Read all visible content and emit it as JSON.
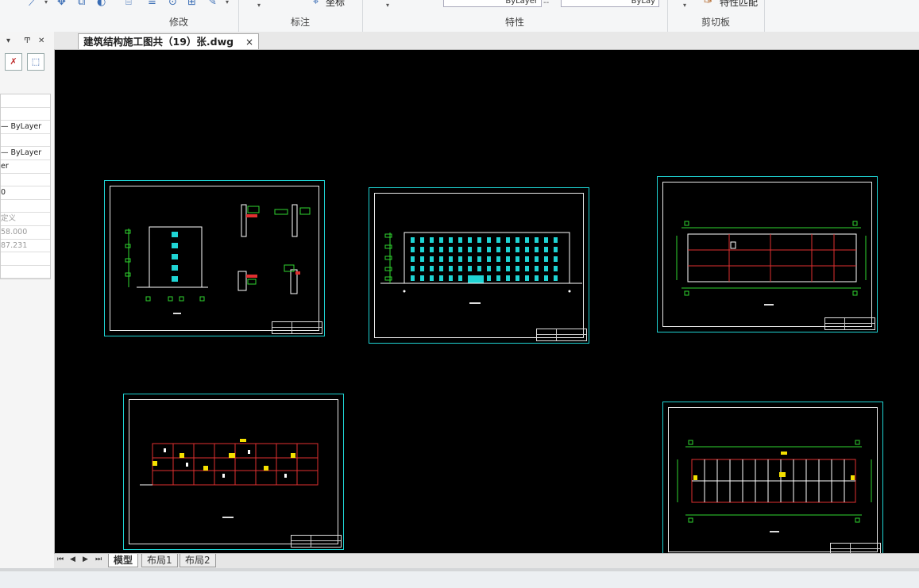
{
  "ribbon": {
    "groups": [
      {
        "label": "修改"
      },
      {
        "label": "标注"
      },
      {
        "label": "特性"
      },
      {
        "label": "剪切板"
      }
    ],
    "annotate_coord_label": "坐标",
    "prop_combo_1": "ByLayer",
    "prop_combo_2": "ByLay",
    "match_label": "特性匹配"
  },
  "left_panel": {
    "rows": [
      {
        "text": ""
      },
      {
        "text": ""
      },
      {
        "text": "— ByLayer"
      },
      {
        "text": ""
      },
      {
        "text": "— ByLayer"
      },
      {
        "text": "er"
      },
      {
        "text": ""
      },
      {
        "text": "0"
      },
      {
        "text": ""
      },
      {
        "text": "定义"
      },
      {
        "text": "58.000"
      },
      {
        "text": "87.231"
      },
      {
        "text": ""
      },
      {
        "text": ""
      }
    ]
  },
  "document": {
    "tab_title": "建筑结构施工图共（19）张.dwg",
    "close_glyph": "×"
  },
  "layout_tabs": [
    {
      "label": "模型",
      "active": true
    },
    {
      "label": "布局1",
      "active": false
    },
    {
      "label": "布局2",
      "active": false
    }
  ],
  "colors": {
    "sheet_border": "#1fd4d4",
    "canvas_bg": "#000000",
    "drawing_red": "#e03030",
    "drawing_green": "#2fd62f",
    "drawing_cyan": "#1fd4d4",
    "drawing_yellow": "#f4e000"
  }
}
